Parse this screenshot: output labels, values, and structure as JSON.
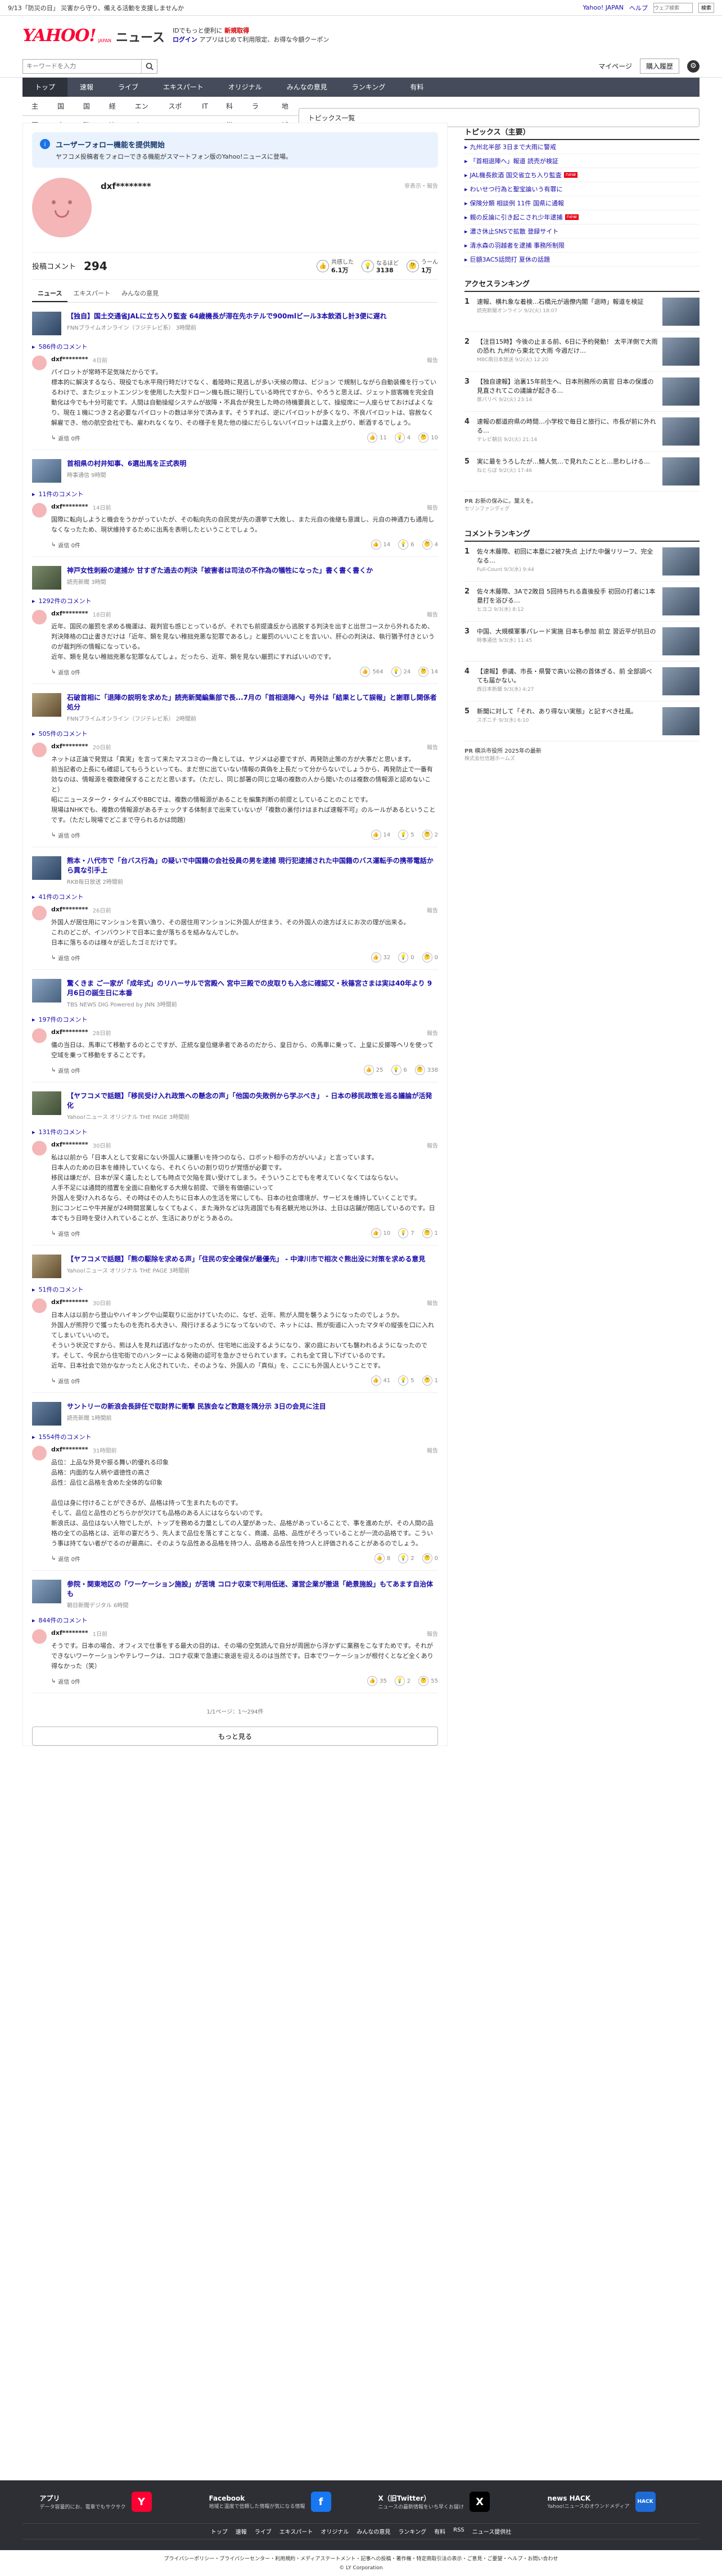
{
  "topbar": {
    "announce": "9/13「防災の日」 災害から守り、備える活動を支援しませんか",
    "right_links": [
      "Yahoo! JAPAN",
      "ヘルプ"
    ],
    "search_placeholder": "ウェブ検索",
    "search_button": "検索"
  },
  "header": {
    "logo": "YAHOO!",
    "logo_sub": "JAPAN",
    "site": "ニュース",
    "promo1": "IDでもっと便利に",
    "promo1_link": "新規取得",
    "promo2_link": "ログイン",
    "promo2": "アプリはじめて利用限定、お得な今額クーポン"
  },
  "search": {
    "placeholder": "キーワードを入力",
    "mypage": "マイページ",
    "purchase": "購入履歴"
  },
  "nav_primary": [
    "トップ",
    "速報",
    "ライブ",
    "エキスパート",
    "オリジナル",
    "みんなの意見",
    "ランキング",
    "有料"
  ],
  "nav_secondary": [
    "主要",
    "国内",
    "国際",
    "経済",
    "エンタメ",
    "スポーツ",
    "IT",
    "科学",
    "ライフ",
    "地域"
  ],
  "nav_secondary_more": "トピックス一覧",
  "notice": {
    "title": "ユーザーフォロー機能を提供開始",
    "text": "ヤフコメ投稿者をフォローできる機能がスマートフォン版のYahoo!ニュースに登場。"
  },
  "profile": {
    "name": "dxf********",
    "report": "非表示・報告",
    "comment_label": "投稿コメント",
    "comment_count": "294",
    "stats": [
      {
        "label": "共感した",
        "value": "6.1万"
      },
      {
        "label": "なるほど",
        "value": "3138"
      },
      {
        "label": "うーん",
        "value": "1万"
      }
    ]
  },
  "tabs": [
    "ニュース",
    "エキスパート",
    "みんなの意見"
  ],
  "articles": [
    {
      "title": "【独自】国土交通省JALに立ち入り監査 64歳機長が滞在先ホテルで900mlビール3本飲酒し計3便に遅れ",
      "meta": "FNNプライムオンライン（フジテレビ系） 3時間前",
      "count": "586件のコメント",
      "comment": {
        "user": "dxf********",
        "date": "4日前",
        "report": "報告",
        "text": "パイロットが常時不足気味だからです。\n標本的に解決するなら、現役でも水平飛行時だけでなく、着陸時に見逃しが多い天候の際は、ビジョン で規制しながら自動装備を行っているわけで、またジェットエンジンを使用した大型ドローン機も既に現行している時代ですから、やろうと思えば、ジェット旅客機を完全自動化は今でも十分可能です。人間は自動操縦システムが故障・不具合が発生した時の待機要員として、操縦席に一人座らせておけばよくなり、現在１機につき２名必要なパイロットの数は半分で済みます。そうすれば、逆にパイロットが多くなり、不良パイロットは、容赦なく解雇でき、他の航空会社でも、雇われなくなり、その様子を見た他の操にだらしないパイロットは震え上がり、断酒するでしょう。",
        "reply": "返信 0件",
        "r1": "11",
        "r2": "4",
        "r3": "10"
      }
    },
    {
      "title": "首相県の村井知事、6選出馬を正式表明",
      "meta": "時事通信 9時間",
      "count": "11件のコメント",
      "comment": {
        "user": "dxf********",
        "date": "14日前",
        "report": "報告",
        "text": "国際に転向しようと機会をうかがっていたが、その転向先の自民党が先の選挙で大敗し、また元自の後継も意識し、元自の神通力も通用しなくなったため、現状維持するために出馬を表明したということでしょう。",
        "reply": "返信 0件",
        "r1": "14",
        "r2": "6",
        "r3": "4"
      }
    },
    {
      "title": "神戸女性刺殺の逮捕か 甘すぎた過去の判決「被害者は司法の不作為の犠牲になった」書く書く書くか",
      "meta": "読売新聞 3時間",
      "count": "1292件のコメント",
      "comment": {
        "user": "dxf********",
        "date": "18日前",
        "report": "報告",
        "text": "近年、国民の厳罰を求める機運は、裁判官も感じとっているが、それでも前提違反から逃脱する判決を出すと出世コースから外れるため、判決降格の口止書きだけは「近年、類を見ない稚拙兇悪な犯罪であるし」と厳罰のいいことを言いい、肝心の判決は、執行猶予付きというのが裁判所の情報になっている。\n近年、類を見ない稚拙兇悪な犯罪なんてしょ。だったら、近年、類を見ない厳罰にすればいいのです。",
        "reply": "返信 0件",
        "r1": "564",
        "r2": "24",
        "r3": "14"
      }
    },
    {
      "title": "石破首相に「退陣の説明を求めた」読売新聞編集部で長...7月の「首相退陣へ」号外は「結果として誤報」と謝罪し関係者処分",
      "meta": "FNNプライムオンライン（フジテレビ系） 2時間前",
      "count": "505件のコメント",
      "comment": {
        "user": "dxf********",
        "date": "20日前",
        "report": "報告",
        "text": "ネットは正論で発覚は「真実」を言って来たマスコミの一角としては、ヤジメは必要ですが、再発防止策の方が大事だと思います。\n前当記者の上長にも確認してもらうといっても、まだ世に出ていない情報の真偽を上長だって分からないでしょうから、再発防止で一番有効なのは、情報源を複数確保することだと思います。（ただし、同じ部署の同じ立場の複数の人から聞いたのは複数の情報源と認めないこと）\n昭にニュースターク・タイムズやBBCでは、複数の情報源があることを編集判断の前提としていることのことです。\n現場はNHKでも、複数の情報源があるチェックする体制まで出来ていないが「複数の裏付けはまれば速報不可」のルールがあるということです。（ただし現場でどこまで守られるかは問題）",
        "reply": "返信 0件",
        "r1": "14",
        "r2": "5",
        "r3": "2"
      }
    },
    {
      "title": "熊本・八代市で「台バス行為」の疑いで中国籍の会社役員の男を逮捕 現行犯逮捕された中国籍のバス運転手の携帯電話から異な引手上",
      "meta": "RKB毎日放送 2時間前",
      "count": "41件のコメント",
      "comment": {
        "user": "dxf********",
        "date": "26日前",
        "report": "報告",
        "text": "外国人が居住用にマンションを買い漁り、その居住用マンションに外国人が住まう、その外国人の途方ばえにお次の理が出来る。\nこれのどこが、インバウンドで日本に金が落ちるを結みなんでしか。\n日本に落ちるのは様々が近したゴミだけです。",
        "reply": "返信 0件",
        "r1": "32",
        "r2": "0",
        "r3": "0"
      }
    },
    {
      "title": "驚くきま ご一家が「成年式」のリハーサルで宮殿へ 宮中三殿での皮取りも入念に確認又・秋篠宮さまは実は40年より 9月6日の誕生日に本番",
      "meta": "TBS NEWS DIG Powered by JNN 3時間前",
      "count": "197件のコメント",
      "comment": {
        "user": "dxf********",
        "date": "28日前",
        "report": "報告",
        "text": "儀の当日は、馬車にて移動するのとこですが、正統な皇位継承者であるのだから、皇日から、の馬車に乗って、上皇に反擲等ヘリを使って空域を乗って移動をすることです。",
        "reply": "返信 0件",
        "r1": "25",
        "r2": "6",
        "r3": "338"
      }
    },
    {
      "title": "【ヤフコメで話題】「移民受け入れ政策への懸念の声」「他国の失敗例から学ぶべき」 - 日本の移民政策を巡る議論が活発化",
      "meta": "Yahoo!ニュース オリジナル THE PAGE 3時間前",
      "count": "131件のコメント",
      "comment": {
        "user": "dxf********",
        "date": "30日前",
        "report": "報告",
        "text": "私は以前から「日本人として安易にない外国人に嫌悪いを持つのなら、ロボット相手の方がいいよ」と言っています。\n日本人のための日本を維持していくなら、それくらいの割り切りが覚悟が必要です。\n移民は嫌だが、日本が深く遺したとしても時点で欠陥を買い受けてしまう。そういうことでもを考えていくなくてはならない。\n人手不足には通問的措置を全面に自動化する大規な前提、で頭を有価値にいって\n外国人を受け入れるなら、その時はその人たちに日本人の生活を常にしても、日本の社会環境が、サービスを維持していくことです。\n別にコンビニや牛丼屋が24時間営業しなくてもよく、また海外などは先週国でも有名観光地以外は、土日は店舗が閉店しているのです。日本でもう日時を受け入れていることが、生活にありがとうあるの。",
        "reply": "返信 0件",
        "r1": "10",
        "r2": "7",
        "r3": "1"
      }
    },
    {
      "title": "【ヤフコメで話題】「熊の駆除を求める声」「住民の安全確保が最優先」 - 中津川市で相次ぐ熊出没に対策を求める意見",
      "meta": "Yahoo!ニュース オリジナル THE PAGE 3時間前",
      "count": "51件のコメント",
      "comment": {
        "user": "dxf********",
        "date": "30日前",
        "report": "報告",
        "text": "日本人は以前から登山やハイキングや山菜取りに出かけていたのに、なぜ、近年、熊が人間を襲うようになったのでしょうか。\n外国人が熊狩りで獲ったものを売れる大きい、飛行けまるようになってないので、ネットには、熊が街道に入ったマタギの縦張を口に入れてしまいていいので。\nそういう状況ですから、熊は人を見れば逃げなかったのが、住宅地に出没するようになり、家の庭においても襲われるようになったのです。そして、今民から住宅街でのハンターによる発砲の認可を急かさせられています。これも全て貸し下げているのです。\n近年、日本社会で効かなかったと人化されていた、そのような、外国人の「真似」を、ここにも外国人ということです。",
        "reply": "返信 0件",
        "r1": "41",
        "r2": "5",
        "r3": "1"
      }
    },
    {
      "title": "サントリーの新浪会長辞任で取財界に衝撃 民族会など数題を隅分示 3日の会見に注目",
      "meta": "読売新聞 1時間前",
      "count": "1554件のコメント",
      "comment": {
        "user": "dxf********",
        "date": "31時間前",
        "report": "報告",
        "text": "品位：上品な外見や振る舞い的優れる印象\n品格：内面的な人柄や道徳性の高さ\n品性：品位と品格を含めた全体的な印象\n\n品位は身に付けることができるが、品格は持って生まれたものです。\nそして、品位と品性のどちらかが欠けても品格のある人にはならないのです。\n新浪氏は、品位はない人物でしたが、トップを務める力量としての人望があった、品格があっていることで、事を進めたが、その人間の品格の全ての品格とは、近年の宴だろう、先人まで品位を落とすことなく、商議、品格、品性がそろっていることが一流の品格です。こういう事は持てない者がでるのが最高に、そのような品性ある品格を持つ人、品格ある品性を持つ人と評価されることがあるのでしょう。",
        "reply": "返信 0件",
        "r1": "8",
        "r2": "2",
        "r3": "0"
      }
    },
    {
      "title": "参院・関東地区の「ワーケーション施設」が苦境 コロナ収束で利用低迷、運営企業が撤退「絶景施設」もてあます自治体も",
      "meta": "朝日新聞デジタル 6時間",
      "count": "844件のコメント",
      "comment": {
        "user": "dxf********",
        "date": "1日前",
        "report": "報告",
        "text": "そうです。日本の場合、オフィスで仕事をする最大の目的は、その場の空気読んで自分が周囲から浮かずに業務をこなすためです。それができないワーケーションやテレワークは、コロナ収束で急速に衰退を迎えるのは当然です。日本でワーケーションが根付くとなど全くあり得なかった（笑）",
        "reply": "返信 0件",
        "r1": "35",
        "r2": "2",
        "r3": "55"
      }
    }
  ],
  "pager": "1/1ページ：1～294件",
  "more_button": "もっと見る",
  "sidebar": {
    "topics_title": "トピックス（主要）",
    "topics": [
      {
        "text": "九州北半部 3日まで大雨に警戒",
        "badge": ""
      },
      {
        "text": "「首相退陣へ」報道 読売が検証",
        "badge": ""
      },
      {
        "text": "JAL機長飲酒 国交省立ち入り監査",
        "badge": "new"
      },
      {
        "text": "わいせつ行為と聖宝論いう有罪に",
        "badge": ""
      },
      {
        "text": "保険分類 相談例 11件 国県に通報",
        "badge": ""
      },
      {
        "text": "親の反論に引き起こされ少年逮捕",
        "badge": "new"
      },
      {
        "text": "濃さ休止SNSで拡散 登録サイト",
        "badge": ""
      },
      {
        "text": "清水森の羽越者を逮捕 事務所制限",
        "badge": ""
      },
      {
        "text": "巨額3AC5話問打 夏休の話題",
        "badge": ""
      }
    ],
    "access_title": "アクセスランキング",
    "access": [
      {
        "no": "1",
        "text": "速報、横れ象な着検...石橋元が過僚内閣「退時」報道を検証",
        "src": "読売新聞オンライン 9/2(火) 18:07"
      },
      {
        "no": "2",
        "text": "【注目15時】今後の止まる前、6日に予約発動！ 太平洋側で大雨の恐れ 九州から東北で大雨 今週だけ…",
        "src": "MBC南日本放送 9/2(火) 12:20"
      },
      {
        "no": "3",
        "text": "【独自速報】治裏15年前生へ、日本刑務所の高官 日本の保護の見直されてこの議論が起きる…",
        "src": "旅パリペ 9/2(火) 23:14"
      },
      {
        "no": "4",
        "text": "速報の都道府県の時間…小学校で毎日と旅行に、市長が前に外れる…",
        "src": "テレビ朝日 9/2(火) 21:14"
      },
      {
        "no": "5",
        "text": "実に最をうろしたが…鯖人気…で見れたことと…思わしける…",
        "src": "ねとらぼ 9/2(火) 17:46"
      }
    ],
    "pr1": "PR",
    "pr1_text": "お新の保みに。葉えを。",
    "pr1_src": "セゾンファンディグ",
    "comment_title": "コメントランキング",
    "comments": [
      {
        "no": "1",
        "text": "佐々木藤際、初回に本塁に2被7失点 上げた中盤リリーフ、完全なる…",
        "src": "Full-Count 9/3(水) 9:44"
      },
      {
        "no": "2",
        "text": "佐々木藤際、3Aで2敗目 5回持ちれる直後投手 初回の打者に1本塁打を浴びる…",
        "src": "ヒヨコ 9/3(水) 8:12"
      },
      {
        "no": "3",
        "text": "中国、大規模軍事パレード実施 日本も参加 前立 習近平が抗日の",
        "src": "時事通信 9/3(水) 11:45"
      },
      {
        "no": "4",
        "text": "【速報】参議、市長・県警で高い公務の首体ぎる、前 全部調べても届かない。",
        "src": "西日本新聞 9/3(水) 4:27"
      },
      {
        "no": "5",
        "text": "新聞に対して「それ、あり得ない実態」と記すべき社風。",
        "src": "スポニチ 9/3(水) 6:10"
      }
    ],
    "pr2": "PR",
    "pr2_text": "横浜市役所 2025年の最新",
    "pr2_src": "株式会社信越ホームズ"
  },
  "footer": {
    "apps": [
      {
        "name": "アプリ",
        "desc": "データ容量的にお、電車でもサクサク",
        "logo": "Y",
        "color": "#ff0033"
      },
      {
        "name": "Facebook",
        "desc": "地域と温度で信頼した情報が気になる情報",
        "logo": "f",
        "color": "#1877f2"
      },
      {
        "name": "X（旧Twitter）",
        "desc": "ニュースの最新情報をいち早くお届け",
        "logo": "X",
        "color": "#000000"
      },
      {
        "name": "news HACK",
        "desc": "Yahoo!ニュースのオウンドメディア",
        "logo": "HACK",
        "color": "#1e6bd6"
      }
    ],
    "links": [
      "トップ",
      "速報",
      "ライブ",
      "エキスパート",
      "オリジナル",
      "みんなの意見",
      "ランキング",
      "有料",
      "RSS",
      "ニュース提供社"
    ],
    "legal": "プライバシーポリシー・プライバシーセンター・利用規約・メディアステートメント・記事への投稿・著作権・特定商取引法の表示・ご意見・ご要望・ヘルプ・お問い合わせ",
    "copyright": "© LY Corporation"
  }
}
